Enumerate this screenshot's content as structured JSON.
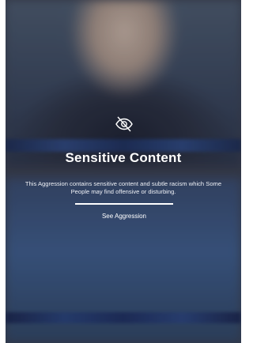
{
  "sensitive": {
    "icon": "eye-slash-icon",
    "title": "Sensitive Content",
    "description": "This Aggression contains sensitive content and subtle racism which Some People may find offensive or disturbing.",
    "action_label": "See Aggression"
  },
  "colors": {
    "text": "#ffffff",
    "divider": "#ffffff"
  }
}
